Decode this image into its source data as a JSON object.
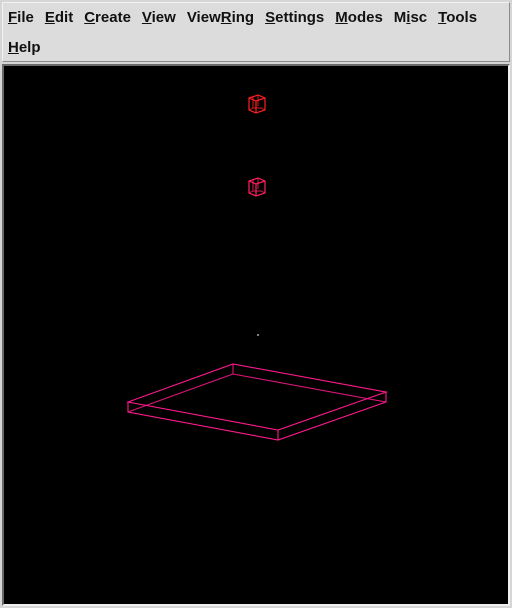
{
  "menubar": {
    "items": [
      {
        "label": "File",
        "mnemonic": 0
      },
      {
        "label": "Edit",
        "mnemonic": 0
      },
      {
        "label": "Create",
        "mnemonic": 0
      },
      {
        "label": "View",
        "mnemonic": 0
      },
      {
        "label": "ViewRing",
        "mnemonic": 4
      },
      {
        "label": "Settings",
        "mnemonic": 0
      },
      {
        "label": "Modes",
        "mnemonic": 0
      },
      {
        "label": "Misc",
        "mnemonic": 1
      },
      {
        "label": "Tools",
        "mnemonic": 0
      },
      {
        "label": "Help",
        "mnemonic": 0
      }
    ]
  },
  "viewport": {
    "background": "#000000",
    "colors": {
      "small_cube": "#ff2020",
      "small_cube_lower": "#ff2060",
      "slab": "#ff1a8c",
      "dot": "#808080"
    }
  }
}
